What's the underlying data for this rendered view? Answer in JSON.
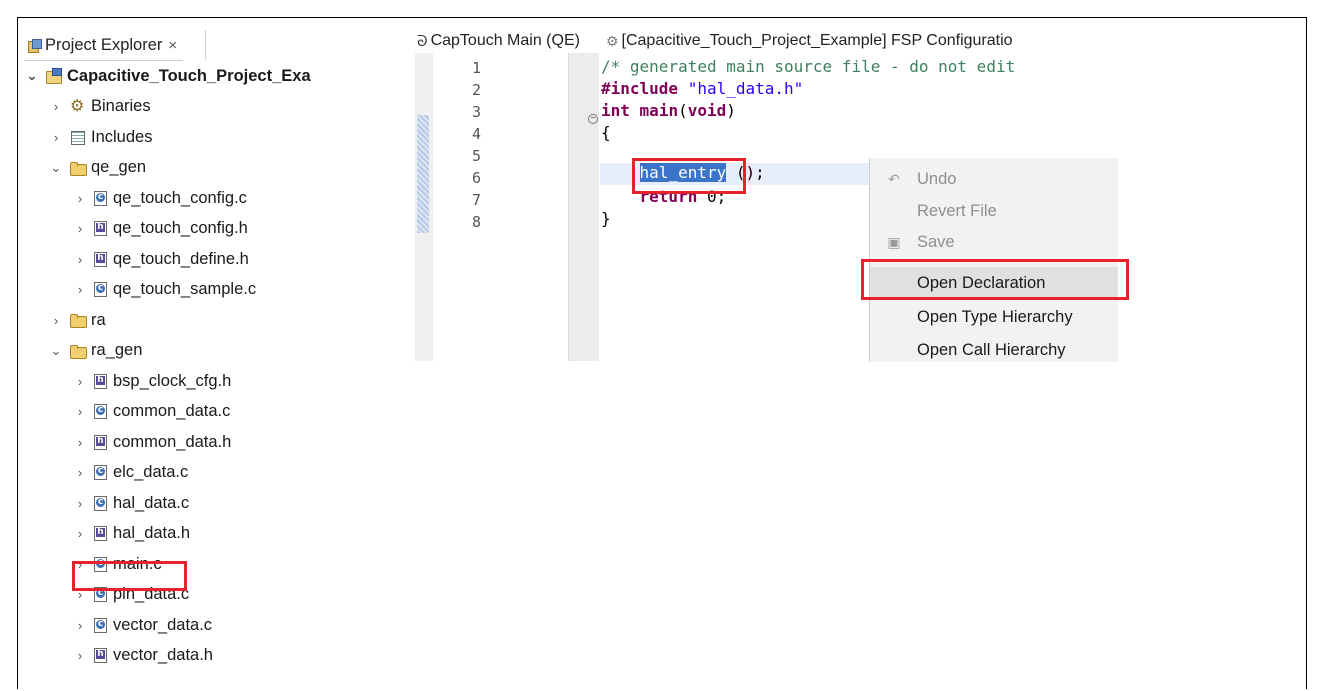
{
  "project_explorer": {
    "tab_label": "Project Explorer",
    "tab_close": "×",
    "tree": [
      {
        "label": "Capacitive_Touch_Project_Exa",
        "chevron": "⌄",
        "icon": "project-icon",
        "bold": true
      },
      {
        "label": "Binaries",
        "chevron": "›",
        "icon": "binaries-icon"
      },
      {
        "label": "Includes",
        "chevron": "›",
        "icon": "includes-icon"
      },
      {
        "label": "qe_gen",
        "chevron": "⌄",
        "icon": "folder-icon"
      },
      {
        "label": "qe_touch_config.c",
        "chevron": "›",
        "icon": "c-file-icon"
      },
      {
        "label": "qe_touch_config.h",
        "chevron": "›",
        "icon": "h-file-icon"
      },
      {
        "label": "qe_touch_define.h",
        "chevron": "›",
        "icon": "h-file-icon"
      },
      {
        "label": "qe_touch_sample.c",
        "chevron": "›",
        "icon": "c-file-icon"
      },
      {
        "label": "ra",
        "chevron": "›",
        "icon": "folder-icon"
      },
      {
        "label": "ra_gen",
        "chevron": "⌄",
        "icon": "folder-icon"
      },
      {
        "label": "bsp_clock_cfg.h",
        "chevron": "›",
        "icon": "h-file-icon"
      },
      {
        "label": "common_data.c",
        "chevron": "›",
        "icon": "c-file-icon"
      },
      {
        "label": "common_data.h",
        "chevron": "›",
        "icon": "h-file-icon"
      },
      {
        "label": "elc_data.c",
        "chevron": "›",
        "icon": "c-file-icon"
      },
      {
        "label": "hal_data.c",
        "chevron": "›",
        "icon": "c-file-icon"
      },
      {
        "label": "hal_data.h",
        "chevron": "›",
        "icon": "h-file-icon"
      },
      {
        "label": "main.c",
        "chevron": "›",
        "icon": "c-file-icon"
      },
      {
        "label": "pin_data.c",
        "chevron": "›",
        "icon": "c-file-icon"
      },
      {
        "label": "vector_data.c",
        "chevron": "›",
        "icon": "c-file-icon"
      },
      {
        "label": "vector_data.h",
        "chevron": "›",
        "icon": "h-file-icon"
      }
    ]
  },
  "editor": {
    "tabs": [
      {
        "label": "CapTouch Main (QE)",
        "icon": "captouch-icon"
      },
      {
        "label": "[Capacitive_Touch_Project_Example] FSP Configuratio",
        "icon": "gear-icon"
      }
    ],
    "line_numbers": [
      "1",
      "2",
      "3",
      "4",
      "5",
      "6",
      "7",
      "8"
    ],
    "code": {
      "l1_comment": "/* generated main source file - do not edit",
      "l2_include_kw": "#include",
      "l2_include_str": "\"hal_data.h\"",
      "l3_int": "int",
      "l3_main": "main",
      "l3_open": "(",
      "l3_void": "void",
      "l3_close": ")",
      "l4": "{",
      "l5_indent": "    ",
      "l5_selected": "hal_entry",
      "l5_rest": " ();",
      "l6_indent": "    ",
      "l6_return": "return",
      "l6_rest": " 0;",
      "l7": "}",
      "fold_marker": "−"
    }
  },
  "context_menu": {
    "items": [
      {
        "label": "Undo",
        "icon": "undo-icon",
        "glyph": "↶",
        "enabled": false
      },
      {
        "label": "Revert File",
        "icon": "",
        "glyph": "",
        "enabled": false
      },
      {
        "label": "Save",
        "icon": "save-icon",
        "glyph": "▣",
        "enabled": false
      },
      {
        "label": "Open Declaration",
        "icon": "",
        "glyph": "",
        "enabled": true
      },
      {
        "label": "Open Type Hierarchy",
        "icon": "",
        "glyph": "",
        "enabled": true
      },
      {
        "label": "Open Call Hierarchy",
        "icon": "",
        "glyph": "",
        "enabled": true
      }
    ]
  },
  "colors": {
    "highlight_box": "#e8212f",
    "selection": "#3b74c8",
    "comment": "#3f7f5f",
    "keyword": "#7f0055",
    "string": "#2a00ff"
  }
}
